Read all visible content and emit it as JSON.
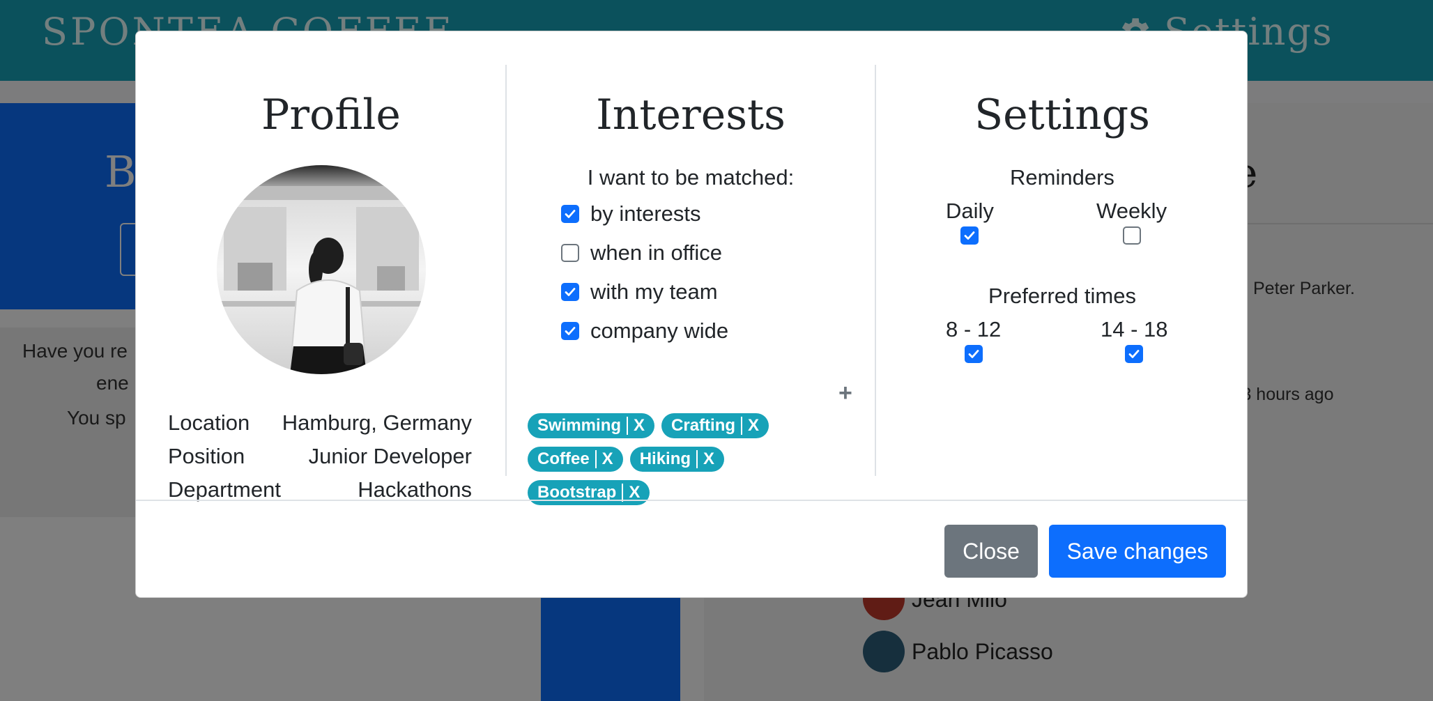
{
  "background": {
    "brand": "SPONTEA COFFEE",
    "settings_label": "Settings",
    "hero_title": "B",
    "gray_lines": [
      "Have you re",
      "ene",
      "You sp"
    ],
    "right_title": "e",
    "peter_text": "Peter Parker.",
    "time_text": "s 3 hours ago",
    "people": [
      "Jean Milo",
      "Pablo Picasso"
    ]
  },
  "profile": {
    "title": "Profile",
    "info": [
      {
        "label": "Location",
        "value": "Hamburg, Germany"
      },
      {
        "label": "Position",
        "value": "Junior Developer"
      },
      {
        "label": "Department",
        "value": "Hackathons"
      }
    ]
  },
  "interests": {
    "title": "Interests",
    "match_heading": "I want to be matched:",
    "options": [
      {
        "label": "by interests",
        "checked": true
      },
      {
        "label": "when in office",
        "checked": false
      },
      {
        "label": "with my team",
        "checked": true
      },
      {
        "label": "company wide",
        "checked": true
      }
    ],
    "add_label": "+",
    "tags": [
      "Swimming",
      "Crafting",
      "Coffee",
      "Hiking",
      "Bootstrap"
    ],
    "remove_label": "X"
  },
  "settings": {
    "title": "Settings",
    "reminders_heading": "Reminders",
    "reminders": [
      {
        "label": "Daily",
        "checked": true
      },
      {
        "label": "Weekly",
        "checked": false
      }
    ],
    "times_heading": "Preferred times",
    "times": [
      {
        "label": "8 - 12",
        "checked": true
      },
      {
        "label": "14 - 18",
        "checked": true
      }
    ]
  },
  "footer": {
    "close_label": "Close",
    "save_label": "Save changes"
  },
  "colors": {
    "primary": "#0d6efd",
    "teal": "#17a2b8",
    "secondary": "#6c757d"
  }
}
